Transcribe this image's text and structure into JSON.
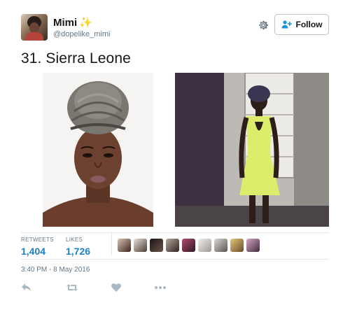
{
  "user": {
    "name": "Mimi",
    "handle": "@dopelike_mimi",
    "verified_emoji": "sparkles-icon"
  },
  "header": {
    "follow_label": "Follow"
  },
  "tweet": {
    "text": "31. Sierra Leone"
  },
  "stats": {
    "retweets_label": "RETWEETS",
    "retweets_value": "1,404",
    "likes_label": "LIKES",
    "likes_value": "1,726"
  },
  "timestamp": "3:40 PM - 8 May 2016",
  "colors": {
    "accent": "#1b7fc4",
    "muted": "#657786",
    "divider": "#e1e8ed"
  },
  "icons": [
    "sparkles-icon",
    "gear-icon",
    "add-user-icon",
    "reply-icon",
    "retweet-icon",
    "like-icon",
    "more-icon"
  ]
}
